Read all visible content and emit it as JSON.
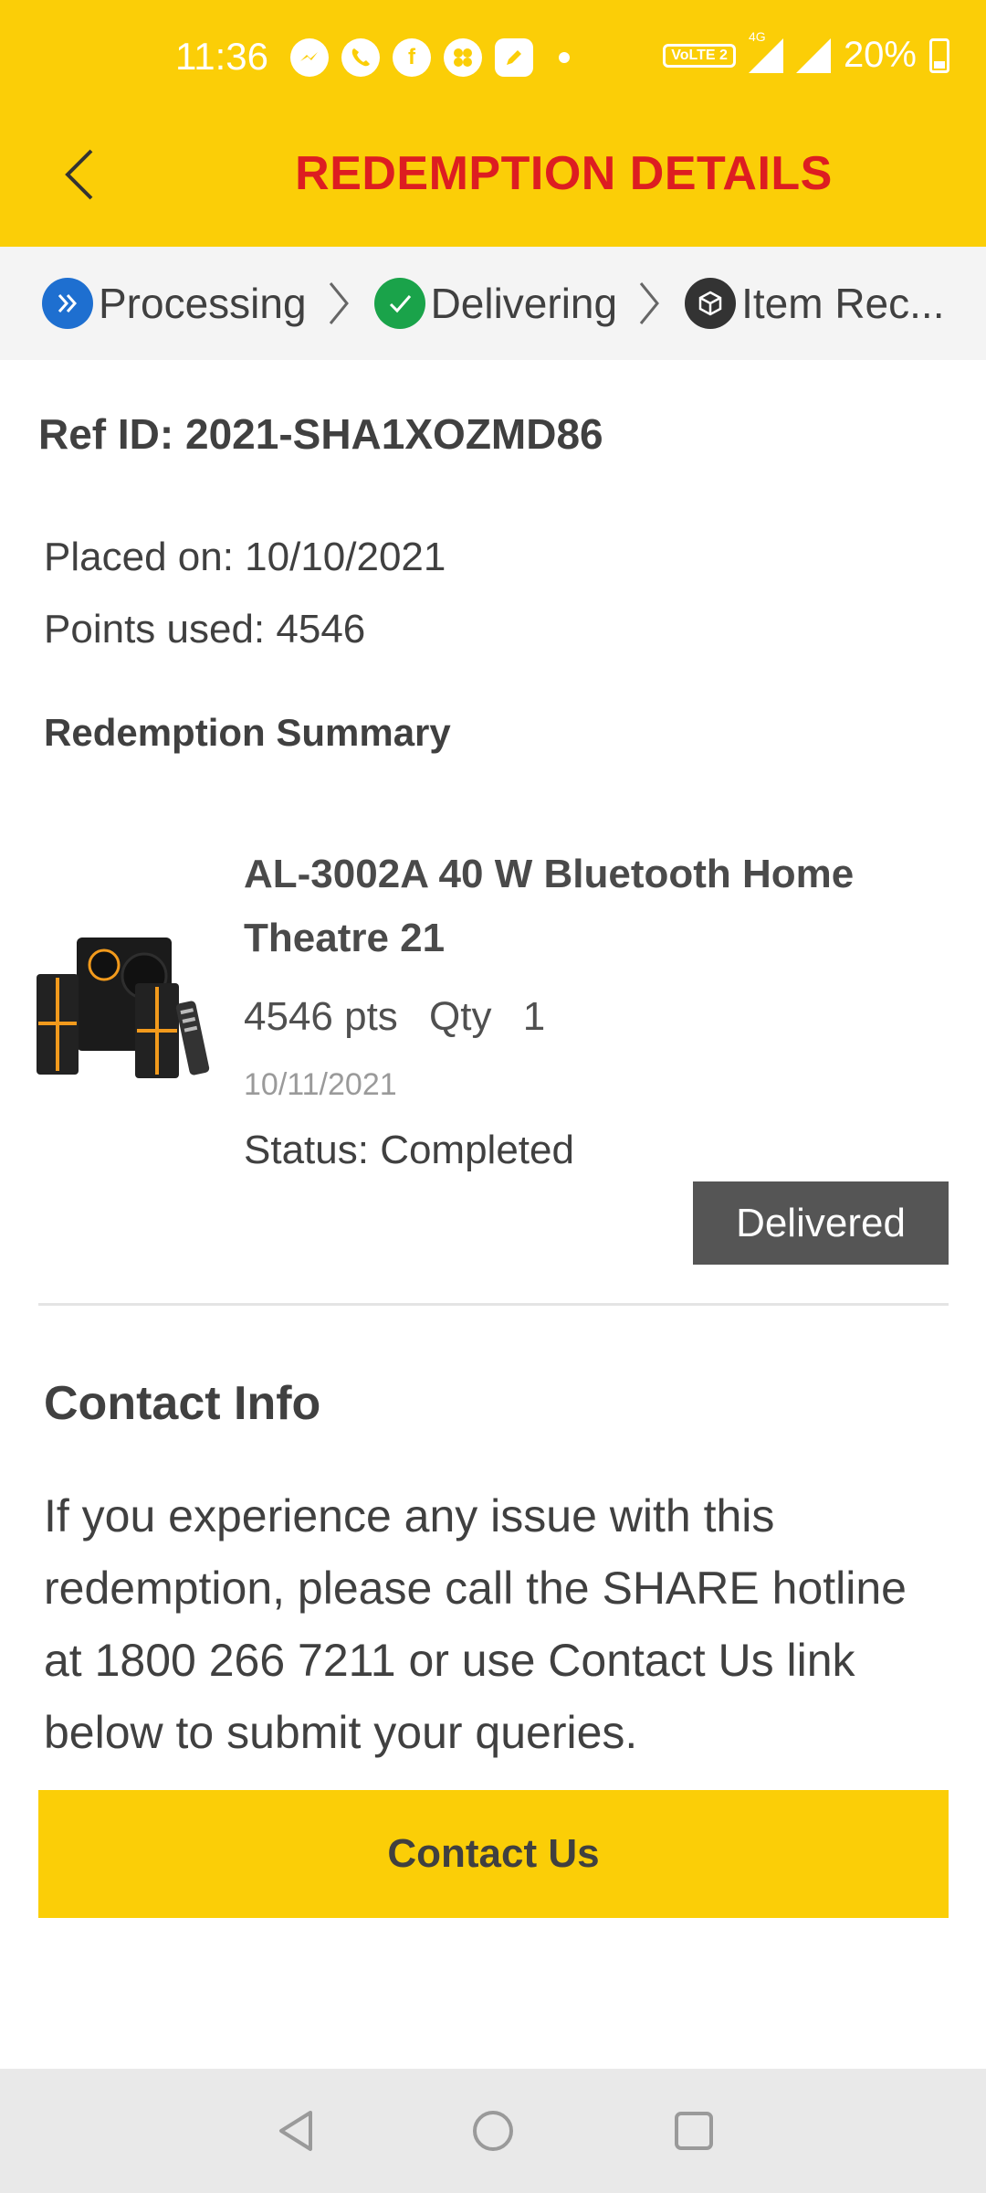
{
  "status_bar": {
    "time": "11:36",
    "notification_icons": [
      "messenger-icon",
      "phone-icon",
      "facebook-icon",
      "fan-icon",
      "edit-icon"
    ],
    "volte_label": "VoLTE 2",
    "network_label": "4G",
    "battery": "20%"
  },
  "header": {
    "title": "REDEMPTION DETAILS",
    "back_icon": "chevron-left-icon",
    "background_color": "#fbce07",
    "title_color": "#dd1d21"
  },
  "stepper": {
    "steps": [
      {
        "label": "Processing",
        "icon": "double-chevron-icon",
        "color": "#1e6fd0"
      },
      {
        "label": "Delivering",
        "icon": "check-icon",
        "color": "#1aa34a"
      },
      {
        "label": "Item Rec...",
        "icon": "box-icon",
        "color": "#333333"
      }
    ]
  },
  "order": {
    "ref_id": "Ref ID: 2021-SHA1XOZMD86",
    "placed_on": "Placed on: 10/10/2021",
    "points_used": "Points used: 4546"
  },
  "summary": {
    "title": "Redemption Summary",
    "item": {
      "name": "AL-3002A 40 W Bluetooth Home Theatre 21",
      "points": "4546 pts",
      "qty_label": "Qty",
      "qty": "1",
      "date": "10/11/2021",
      "status": "Status: Completed",
      "badge": "Delivered",
      "image": "home-theatre-speaker-image"
    }
  },
  "contact": {
    "title": "Contact Info",
    "text": "If you experience any issue with this redemption, please call the SHARE hotline at 1800 266 7211 or use Contact Us link below to submit your queries.",
    "button_label": "Contact Us"
  },
  "nav_bar": {
    "buttons": [
      "back-triangle-icon",
      "home-circle-icon",
      "recents-square-icon"
    ]
  }
}
